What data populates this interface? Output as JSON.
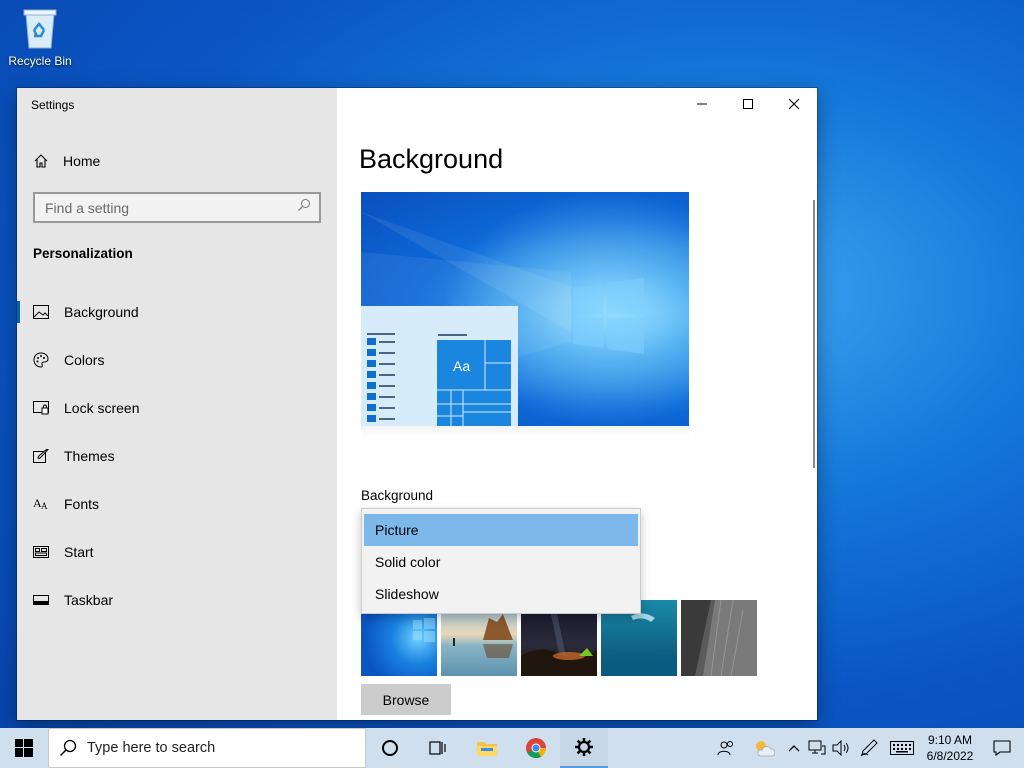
{
  "desktop": {
    "recycle_bin_label": "Recycle Bin"
  },
  "window": {
    "title": "Settings",
    "home_label": "Home",
    "search_placeholder": "Find a setting",
    "section_title": "Personalization",
    "nav_items": [
      {
        "label": "Background",
        "icon": "picture-icon",
        "active": true
      },
      {
        "label": "Colors",
        "icon": "palette-icon",
        "active": false
      },
      {
        "label": "Lock screen",
        "icon": "lock-screen-icon",
        "active": false
      },
      {
        "label": "Themes",
        "icon": "brush-icon",
        "active": false
      },
      {
        "label": "Fonts",
        "icon": "font-icon",
        "active": false
      },
      {
        "label": "Start",
        "icon": "start-icon",
        "active": false
      },
      {
        "label": "Taskbar",
        "icon": "taskbar-icon",
        "active": false
      }
    ]
  },
  "main": {
    "page_title": "Background",
    "preview_tile_text": "Aa",
    "background_label": "Background",
    "dropdown_options": [
      "Picture",
      "Solid color",
      "Slideshow"
    ],
    "dropdown_selected": "Picture",
    "thumbnails": [
      "windows-blue",
      "coastal-rock",
      "night-camp",
      "underwater-diver",
      "rock-cliff"
    ],
    "browse_label": "Browse"
  },
  "taskbar": {
    "search_placeholder": "Type here to search",
    "time": "9:10 AM",
    "date": "6/8/2022"
  },
  "colors": {
    "accent": "#0063b1",
    "dropdown_selected": "#7cb9ea",
    "sidebar": "#e6e6e6",
    "taskbar": "#d6e4f0"
  }
}
